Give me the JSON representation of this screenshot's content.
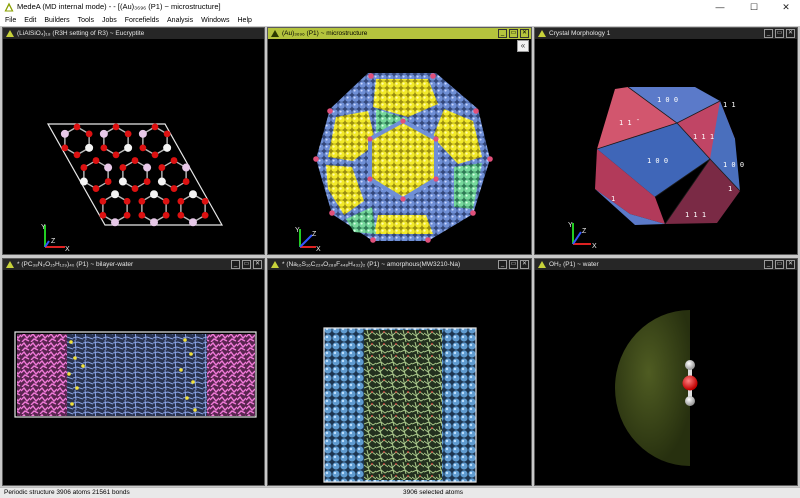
{
  "window": {
    "title": "MedeA (MD internal mode) - - [(Au)₃₆₉₆ (P1) ~ microstructure]",
    "minimize": "—",
    "maximize": "☐",
    "close": "✕"
  },
  "menu": [
    "File",
    "Edit",
    "Builders",
    "Tools",
    "Jobs",
    "Forcefields",
    "Analysis",
    "Windows",
    "Help"
  ],
  "panels": [
    {
      "title": "(LiAlSiO₄)₁₈ (R3H setting of R3) ~ Eucryptite"
    },
    {
      "title": "(Au)₃₆₉₆ (P1) ~ microstructure"
    },
    {
      "title": "Crystal Morphology 1"
    },
    {
      "title": "* (PC₃₈N₂O₁₅H₁₂₉)₄₀ (P1) ~ bilayer-water"
    },
    {
      "title": "* (Na₁₆S₁₆C₂₂₄O₂₈₈F₄₄₈H₄₃₂)₂ (P1) ~ amorphous(MW3210-Na)"
    },
    {
      "title": "OH₂ (P1) ~ water"
    }
  ],
  "panel_buttons": {
    "min": "_",
    "max": "▭",
    "close": "✕"
  },
  "collapse_button": "«",
  "axes": {
    "x": "X",
    "y": "Y",
    "z": "Z"
  },
  "morphology_faces": {
    "top": "1 0 0",
    "right_top": "1 1",
    "left_red": "1 1 ̄",
    "center": "1 0 0",
    "right_mid": "1 1 1",
    "far_right": "1 0 0",
    "left_low": "1",
    "right_low": "1",
    "bottom": "1 1 1"
  },
  "status": {
    "left": "Periodic structure  3906 atoms  21561 bonds",
    "middle": "3906 selected atoms"
  },
  "colors": {
    "active_header": "#b5c43d",
    "viewport_bg": "#000000",
    "gold_atom": "#f3ea2a",
    "blue_atom": "#6f8fd6",
    "green_atom": "#76d99c",
    "magenta_atom": "#e0507a"
  }
}
